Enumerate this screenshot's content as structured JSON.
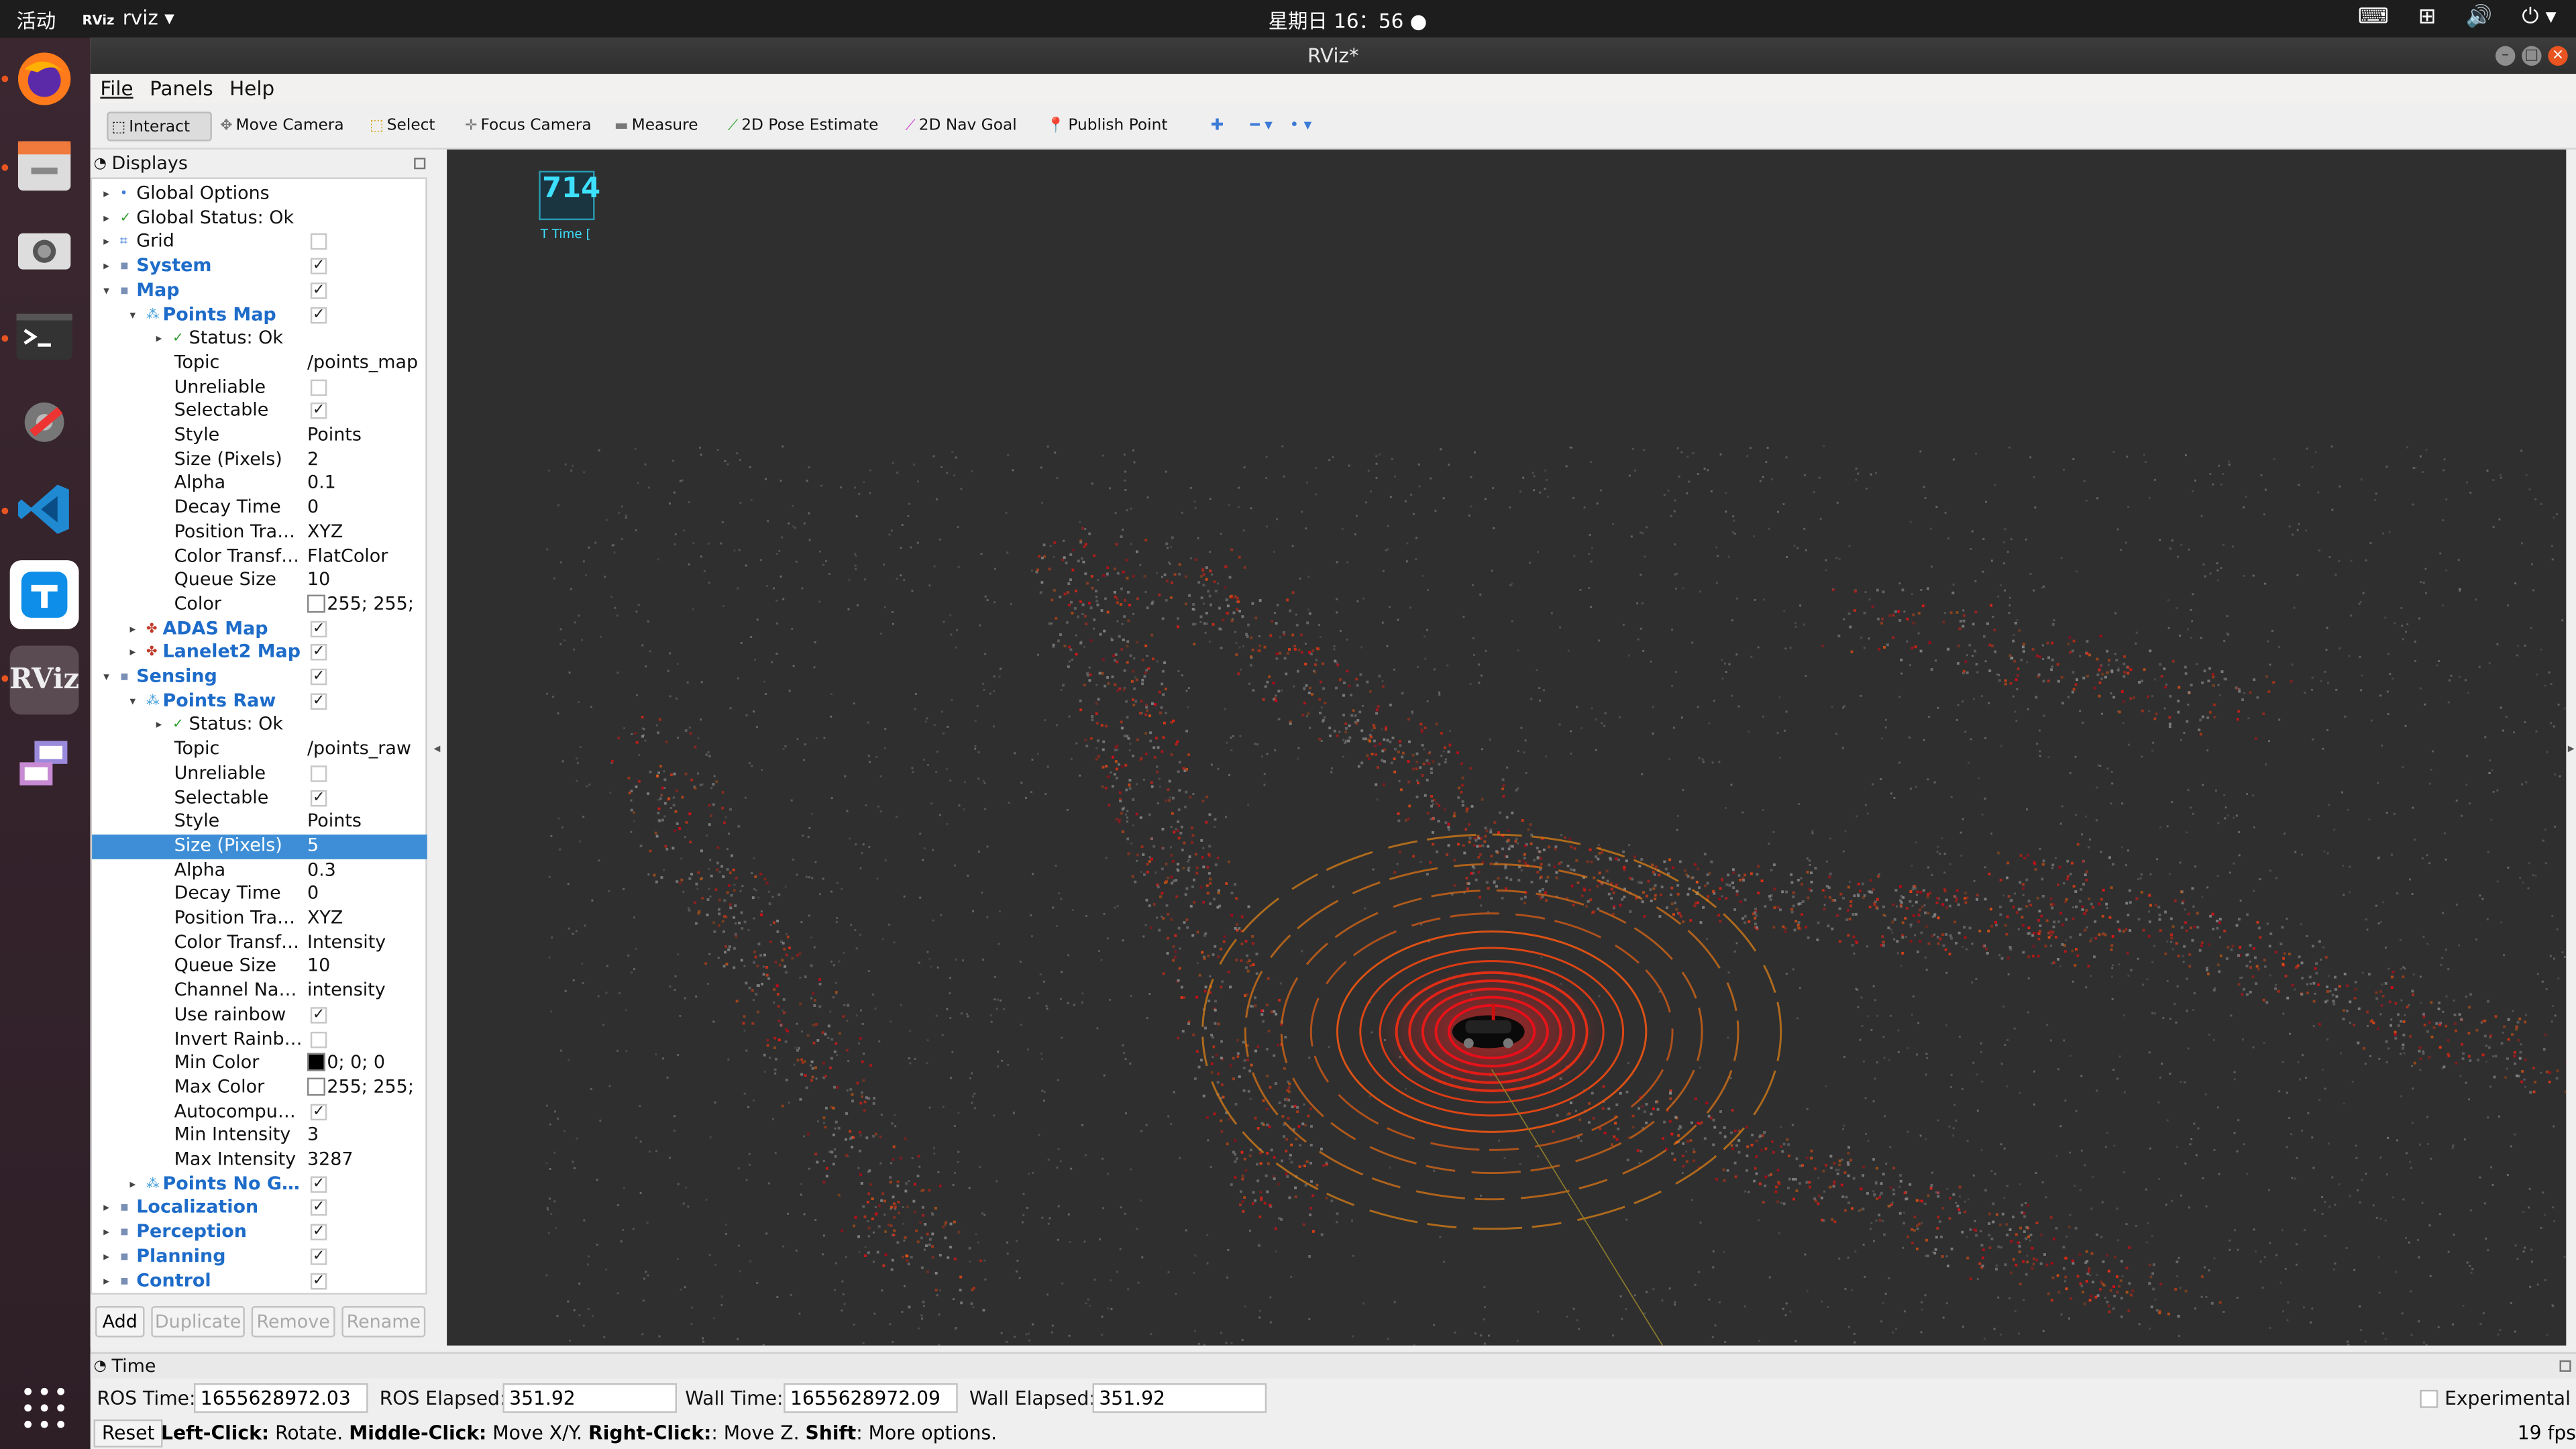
{
  "topbar": {
    "activities": "活动",
    "app_badge": "RViz",
    "app_name": "rviz",
    "clock": "星期日 16：56"
  },
  "window": {
    "title": "RViz*"
  },
  "menu": [
    "File",
    "Panels",
    "Help"
  ],
  "toolbar": {
    "interact": "Interact",
    "move_camera": "Move Camera",
    "select": "Select",
    "focus_camera": "Focus Camera",
    "measure": "Measure",
    "pose_estimate": "2D Pose Estimate",
    "nav_goal": "2D Nav Goal",
    "publish_point": "Publish Point"
  },
  "displays": {
    "header": "Displays",
    "rows": [
      {
        "label": "Global Options",
        "value": "",
        "chk": "",
        "bold": false,
        "indent": 0,
        "arrow": "right",
        "icon": "dot"
      },
      {
        "label": "Global Status: Ok",
        "value": "",
        "chk": "",
        "bold": false,
        "indent": 0,
        "arrow": "right",
        "icon": "check"
      },
      {
        "label": "Grid",
        "value": "",
        "chk": "off",
        "bold": false,
        "indent": 0,
        "arrow": "right",
        "icon": "grid"
      },
      {
        "label": "System",
        "value": "",
        "chk": "on",
        "bold": true,
        "indent": 0,
        "arrow": "right",
        "icon": "folder"
      },
      {
        "label": "Map",
        "value": "",
        "chk": "on",
        "bold": true,
        "indent": 0,
        "arrow": "down",
        "icon": "folder"
      },
      {
        "label": "Points Map",
        "value": "",
        "chk": "on",
        "bold": true,
        "indent": 1,
        "arrow": "down",
        "icon": "cloud"
      },
      {
        "label": "Status: Ok",
        "value": "",
        "chk": "",
        "bold": false,
        "indent": 2,
        "arrow": "right",
        "icon": "check"
      },
      {
        "label": "Topic",
        "value": "/points_map",
        "chk": "",
        "bold": false,
        "indent": 3,
        "arrow": "",
        "icon": ""
      },
      {
        "label": "Unreliable",
        "value": "",
        "chk": "off",
        "bold": false,
        "indent": 3,
        "arrow": "",
        "icon": ""
      },
      {
        "label": "Selectable",
        "value": "",
        "chk": "on",
        "bold": false,
        "indent": 3,
        "arrow": "",
        "icon": ""
      },
      {
        "label": "Style",
        "value": "Points",
        "chk": "",
        "bold": false,
        "indent": 3,
        "arrow": "",
        "icon": ""
      },
      {
        "label": "Size (Pixels)",
        "value": "2",
        "chk": "",
        "bold": false,
        "indent": 3,
        "arrow": "",
        "icon": ""
      },
      {
        "label": "Alpha",
        "value": "0.1",
        "chk": "",
        "bold": false,
        "indent": 3,
        "arrow": "",
        "icon": ""
      },
      {
        "label": "Decay Time",
        "value": "0",
        "chk": "",
        "bold": false,
        "indent": 3,
        "arrow": "",
        "icon": ""
      },
      {
        "label": "Position Tra…",
        "value": "XYZ",
        "chk": "",
        "bold": false,
        "indent": 3,
        "arrow": "",
        "icon": ""
      },
      {
        "label": "Color Transf…",
        "value": "FlatColor",
        "chk": "",
        "bold": false,
        "indent": 3,
        "arrow": "",
        "icon": ""
      },
      {
        "label": "Queue Size",
        "value": "10",
        "chk": "",
        "bold": false,
        "indent": 3,
        "arrow": "",
        "icon": ""
      },
      {
        "label": "Color",
        "value": "255; 255;",
        "chk": "",
        "bold": false,
        "indent": 3,
        "arrow": "",
        "icon": "",
        "swatch": "#ffffff"
      },
      {
        "label": "ADAS Map",
        "value": "",
        "chk": "on",
        "bold": true,
        "indent": 1,
        "arrow": "right",
        "icon": "multi"
      },
      {
        "label": "Lanelet2 Map",
        "value": "",
        "chk": "on",
        "bold": true,
        "indent": 1,
        "arrow": "right",
        "icon": "multi"
      },
      {
        "label": "Sensing",
        "value": "",
        "chk": "on",
        "bold": true,
        "indent": 0,
        "arrow": "down",
        "icon": "folder"
      },
      {
        "label": "Points Raw",
        "value": "",
        "chk": "on",
        "bold": true,
        "indent": 1,
        "arrow": "down",
        "icon": "cloud"
      },
      {
        "label": "Status: Ok",
        "value": "",
        "chk": "",
        "bold": false,
        "indent": 2,
        "arrow": "right",
        "icon": "check"
      },
      {
        "label": "Topic",
        "value": "/points_raw",
        "chk": "",
        "bold": false,
        "indent": 3,
        "arrow": "",
        "icon": ""
      },
      {
        "label": "Unreliable",
        "value": "",
        "chk": "off",
        "bold": false,
        "indent": 3,
        "arrow": "",
        "icon": ""
      },
      {
        "label": "Selectable",
        "value": "",
        "chk": "on",
        "bold": false,
        "indent": 3,
        "arrow": "",
        "icon": ""
      },
      {
        "label": "Style",
        "value": "Points",
        "chk": "",
        "bold": false,
        "indent": 3,
        "arrow": "",
        "icon": ""
      },
      {
        "label": "Size (Pixels)",
        "value": "5",
        "chk": "",
        "bold": false,
        "indent": 3,
        "arrow": "",
        "icon": "",
        "selected": true
      },
      {
        "label": "Alpha",
        "value": "0.3",
        "chk": "",
        "bold": false,
        "indent": 3,
        "arrow": "",
        "icon": ""
      },
      {
        "label": "Decay Time",
        "value": "0",
        "chk": "",
        "bold": false,
        "indent": 3,
        "arrow": "",
        "icon": ""
      },
      {
        "label": "Position Tra…",
        "value": "XYZ",
        "chk": "",
        "bold": false,
        "indent": 3,
        "arrow": "",
        "icon": ""
      },
      {
        "label": "Color Transf…",
        "value": "Intensity",
        "chk": "",
        "bold": false,
        "indent": 3,
        "arrow": "",
        "icon": ""
      },
      {
        "label": "Queue Size",
        "value": "10",
        "chk": "",
        "bold": false,
        "indent": 3,
        "arrow": "",
        "icon": ""
      },
      {
        "label": "Channel Name",
        "value": "intensity",
        "chk": "",
        "bold": false,
        "indent": 3,
        "arrow": "",
        "icon": ""
      },
      {
        "label": "Use rainbow",
        "value": "",
        "chk": "on",
        "bold": false,
        "indent": 3,
        "arrow": "",
        "icon": ""
      },
      {
        "label": "Invert Rainb…",
        "value": "",
        "chk": "off",
        "bold": false,
        "indent": 3,
        "arrow": "",
        "icon": ""
      },
      {
        "label": "Min Color",
        "value": "0; 0; 0",
        "chk": "",
        "bold": false,
        "indent": 3,
        "arrow": "",
        "icon": "",
        "swatch": "#000000"
      },
      {
        "label": "Max Color",
        "value": "255; 255;",
        "chk": "",
        "bold": false,
        "indent": 3,
        "arrow": "",
        "icon": "",
        "swatch": "#ffffff"
      },
      {
        "label": "Autocomput…",
        "value": "",
        "chk": "on",
        "bold": false,
        "indent": 3,
        "arrow": "",
        "icon": ""
      },
      {
        "label": "Min Intensity",
        "value": "3",
        "chk": "",
        "bold": false,
        "indent": 3,
        "arrow": "",
        "icon": ""
      },
      {
        "label": "Max Intensity",
        "value": "3287",
        "chk": "",
        "bold": false,
        "indent": 3,
        "arrow": "",
        "icon": ""
      },
      {
        "label": "Points No Gr…",
        "value": "",
        "chk": "on",
        "bold": true,
        "indent": 1,
        "arrow": "right",
        "icon": "cloud"
      },
      {
        "label": "Localization",
        "value": "",
        "chk": "on",
        "bold": true,
        "indent": 0,
        "arrow": "right",
        "icon": "folder"
      },
      {
        "label": "Perception",
        "value": "",
        "chk": "on",
        "bold": true,
        "indent": 0,
        "arrow": "right",
        "icon": "folder"
      },
      {
        "label": "Planning",
        "value": "",
        "chk": "on",
        "bold": true,
        "indent": 0,
        "arrow": "right",
        "icon": "folder"
      },
      {
        "label": "Control",
        "value": "",
        "chk": "on",
        "bold": true,
        "indent": 0,
        "arrow": "right",
        "icon": "folder"
      }
    ],
    "buttons": {
      "add": "Add",
      "duplicate": "Duplicate",
      "remove": "Remove",
      "rename": "Rename"
    }
  },
  "viewport": {
    "overlay_value": "714",
    "overlay_label": "T Time ["
  },
  "time_panel": {
    "header": "Time",
    "ros_time_label": "ROS Time:",
    "ros_time": "1655628972.03",
    "ros_elapsed_label": "ROS Elapsed:",
    "ros_elapsed": "351.92",
    "wall_time_label": "Wall Time:",
    "wall_time": "1655628972.09",
    "wall_elapsed_label": "Wall Elapsed:",
    "wall_elapsed": "351.92",
    "experimental": "Experimental"
  },
  "statusbar": {
    "reset": "Reset",
    "left_click": "Left-Click:",
    "left_desc": " Rotate. ",
    "middle_click": "Middle-Click:",
    "middle_desc": " Move X/Y. ",
    "right_click": "Right-Click:",
    "right_desc": ": Move Z. ",
    "shift": "Shift",
    "shift_desc": ": More options.",
    "fps": "19 fps"
  },
  "colors": {
    "selection": "#3d8ed6",
    "link_blue": "#1e6cc9",
    "viewport_bg": "#2f2f2f",
    "ubuntu_orange": "#e95420"
  }
}
